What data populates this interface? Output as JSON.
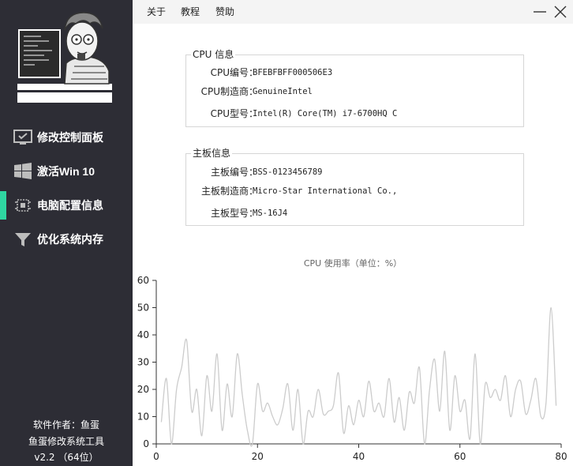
{
  "menu": {
    "about": "关于",
    "tutorial": "教程",
    "donate": "赞助"
  },
  "sidebar": {
    "items": [
      {
        "label": "修改控制面板",
        "icon": "monitor-check-icon"
      },
      {
        "label": "激活Win 10",
        "icon": "windows-logo-icon"
      },
      {
        "label": "电脑配置信息",
        "icon": "chip-icon",
        "active": true
      },
      {
        "label": "优化系统内存",
        "icon": "funnel-icon"
      }
    ],
    "footer": {
      "author": "软件作者：鱼蛋",
      "app_name": "鱼蛋修改系统工具",
      "version": "v2.2 （64位）"
    }
  },
  "cpu_group": {
    "title": "CPU 信息",
    "rows": [
      {
        "label": "CPU编号：",
        "value": "BFEBFBFF000506E3"
      },
      {
        "label": "CPU制造商：",
        "value": "GenuineIntel"
      },
      {
        "label": "CPU型号：",
        "value": "Intel(R) Core(TM) i7-6700HQ C"
      }
    ]
  },
  "board_group": {
    "title": "主板信息",
    "rows": [
      {
        "label": "主板编号：",
        "value": "BSS-0123456789"
      },
      {
        "label": "主板制造商：",
        "value": "Micro-Star International Co.,"
      },
      {
        "label": "主板型号：",
        "value": "MS-16J4"
      }
    ]
  },
  "colors": {
    "sidebar_bg": "#2d2d35",
    "accent": "#2fd6a1",
    "line": "#cccccc"
  },
  "chart_data": {
    "type": "line",
    "title": "CPU 使用率（单位：%）",
    "xlabel": "",
    "ylabel": "",
    "xlim": [
      0,
      80
    ],
    "ylim": [
      0,
      60
    ],
    "xticks": [
      0,
      20,
      40,
      60,
      80
    ],
    "yticks": [
      0,
      10,
      20,
      30,
      40,
      50,
      60
    ],
    "grid": false,
    "smooth": true,
    "x": [
      1,
      2,
      3,
      4,
      5,
      6,
      7,
      8,
      9,
      10,
      11,
      12,
      13,
      14,
      15,
      16,
      17,
      18,
      19,
      20,
      21,
      22,
      23,
      24,
      25,
      26,
      27,
      28,
      29,
      30,
      31,
      32,
      33,
      34,
      35,
      36,
      37,
      38,
      39,
      40,
      41,
      42,
      43,
      44,
      45,
      46,
      47,
      48,
      49,
      50,
      51,
      52,
      53,
      54,
      55,
      56,
      57,
      58,
      59,
      60,
      61,
      62,
      63,
      64,
      65,
      66,
      67,
      68,
      69,
      70,
      71,
      72,
      73,
      74,
      75,
      76,
      77,
      78,
      79
    ],
    "values": [
      8,
      24,
      0,
      20,
      28,
      38,
      12,
      20,
      3,
      25,
      12,
      33,
      5,
      22,
      10,
      33,
      18,
      5,
      0,
      22,
      12,
      15,
      10,
      7,
      13,
      22,
      5,
      20,
      0,
      12,
      10,
      20,
      11,
      12,
      14,
      26,
      4,
      14,
      7,
      16,
      10,
      23,
      12,
      15,
      10,
      24,
      8,
      17,
      5,
      19,
      15,
      28,
      0,
      20,
      31,
      12,
      34,
      5,
      25,
      12,
      16,
      2,
      33,
      0,
      22,
      17,
      20,
      16,
      25,
      10,
      20,
      23,
      11,
      16,
      24,
      10,
      15,
      50,
      14
    ],
    "series": [
      {
        "values_ref": "values",
        "color": "#cccccc"
      }
    ]
  }
}
